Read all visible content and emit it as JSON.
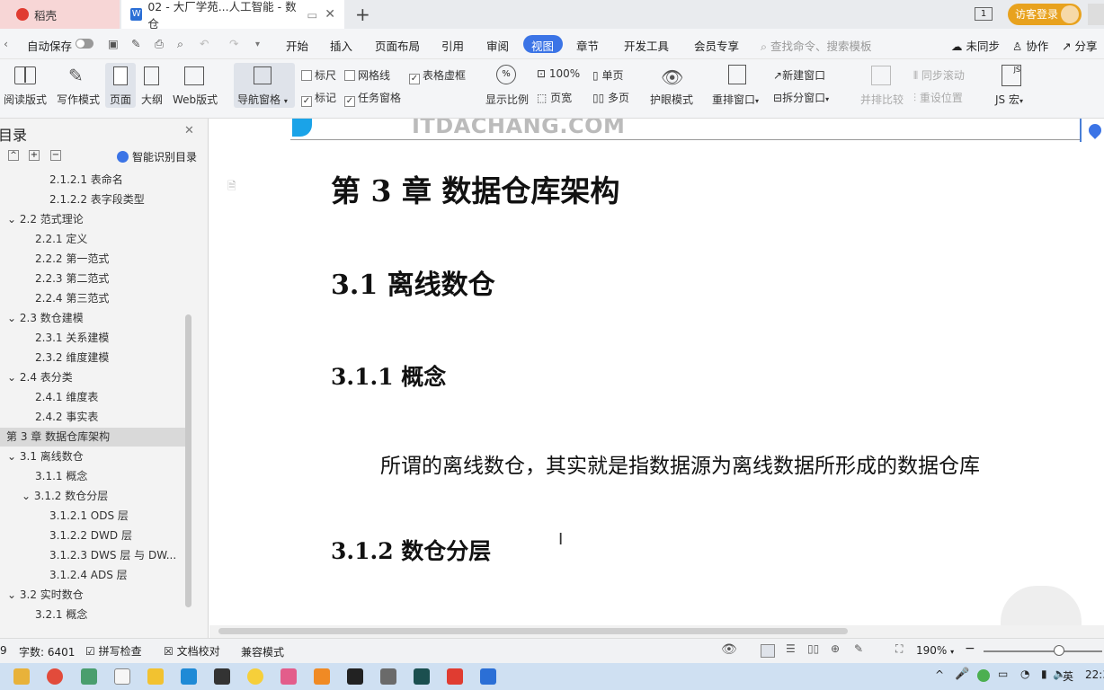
{
  "tabs": [
    {
      "label": "稻壳"
    },
    {
      "label": "02 - 大厂学苑...人工智能 - 数仓"
    }
  ],
  "title_right": {
    "badge": "1",
    "login": "访客登录"
  },
  "menu": {
    "autosave": "自动保存",
    "items": [
      "开始",
      "插入",
      "页面布局",
      "引用",
      "审阅",
      "视图",
      "章节",
      "开发工具",
      "会员专享"
    ],
    "search_placeholder": "查找命令、搜索模板",
    "right": [
      "未同步",
      "协作",
      "分享"
    ]
  },
  "toolbar": {
    "read": "阅读版式",
    "write": "写作模式",
    "page": "页面",
    "outline": "大纲",
    "web": "Web版式",
    "nav": "导航窗格",
    "ruler": "标尺",
    "grid": "网格线",
    "tableframe": "表格虚框",
    "mark": "标记",
    "taskpane": "任务窗格",
    "ratio": "显示比例",
    "zoom100": "100%",
    "pagewidth": "页宽",
    "single": "单页",
    "multi": "多页",
    "eye": "护眼模式",
    "rearrange": "重排窗口",
    "newwin": "新建窗口",
    "splitwin": "拆分窗口",
    "compare": "并排比较",
    "syncscroll": "同步滚动",
    "resetpos": "重设位置",
    "jsmacro": "JS 宏"
  },
  "sidebar": {
    "title": "目录",
    "smart": "智能识别目录",
    "items": [
      {
        "label": "2.1.2.1  表命名"
      },
      {
        "label": "2.1.2.2  表字段类型"
      },
      {
        "label": "2.2    范式理论"
      },
      {
        "label": "2.2.1  定义"
      },
      {
        "label": "2.2.2  第一范式"
      },
      {
        "label": "2.2.3  第二范式"
      },
      {
        "label": "2.2.4  第三范式"
      },
      {
        "label": "2.3    数仓建模"
      },
      {
        "label": "2.3.1  关系建模"
      },
      {
        "label": "2.3.2  维度建模"
      },
      {
        "label": "2.4    表分类"
      },
      {
        "label": "2.4.1  维度表"
      },
      {
        "label": "2.4.2  事实表"
      },
      {
        "label": "第 3 章  数据仓库架构"
      },
      {
        "label": "3.1    离线数仓"
      },
      {
        "label": "3.1.1  概念"
      },
      {
        "label": "3.1.2  数仓分层"
      },
      {
        "label": "3.1.2.1 ODS 层"
      },
      {
        "label": "3.1.2.2 DWD 层"
      },
      {
        "label": "3.1.2.3 DWS 层 与 DW..."
      },
      {
        "label": "3.1.2.4 ADS 层"
      },
      {
        "label": "3.2    实时数仓"
      },
      {
        "label": "3.2.1  概念"
      }
    ]
  },
  "document": {
    "logo_text": "ITDACHANG.COM",
    "chapter": "第 3 章    数据仓库架构",
    "h1": "3.1    离线数仓",
    "h2a": "3.1.1  概念",
    "para": "所谓的离线数仓，其实就是指数据源为离线数据所形成的数据仓库",
    "h2b": "3.1.2  数仓分层"
  },
  "status": {
    "page": "9",
    "words": "字数: 6401",
    "spell": "拼写检查",
    "proof": "文档校对",
    "compat": "兼容模式",
    "zoom": "190%"
  },
  "taskbar": {
    "ime": "英",
    "time": "22:3"
  },
  "colors": {
    "accent": "#2b6fd6",
    "view_tab": "#3b74e6",
    "login": "#e8a21e"
  }
}
